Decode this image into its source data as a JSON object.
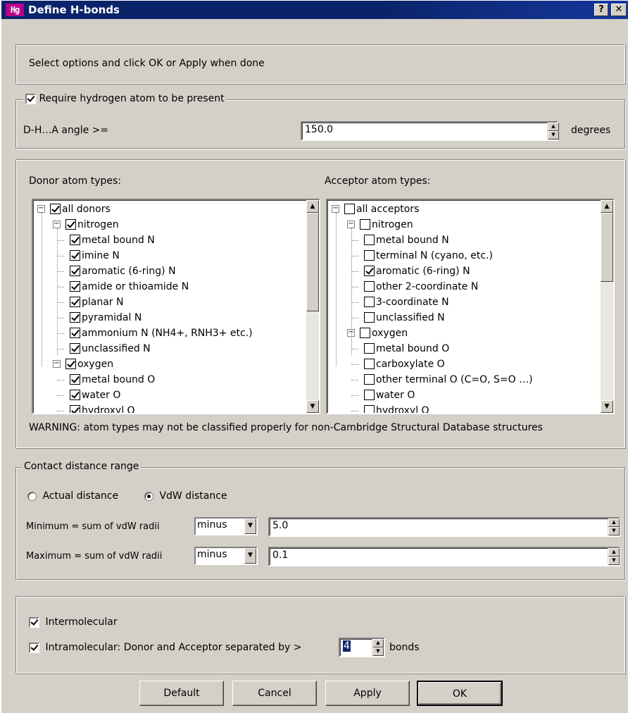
{
  "window": {
    "title": "Define H-bonds",
    "app_icon_text": "Hg",
    "help_btn": "?",
    "close_btn": "✕"
  },
  "intro": {
    "text": "Select options and click OK or Apply when done"
  },
  "hydrogen": {
    "require_label": "Require hydrogen atom to be present",
    "require_checked": true,
    "angle_label": "D-H…A angle >=",
    "angle_value": "150.0",
    "angle_unit": "degrees"
  },
  "donors": {
    "label": "Donor atom types:",
    "items": [
      {
        "label": "all donors",
        "level": 0,
        "checked": true,
        "expander": "−"
      },
      {
        "label": "nitrogen",
        "level": 1,
        "checked": true,
        "expander": "−"
      },
      {
        "label": "metal bound N",
        "level": 2,
        "checked": true
      },
      {
        "label": "imine N",
        "level": 2,
        "checked": true
      },
      {
        "label": "aromatic (6-ring) N",
        "level": 2,
        "checked": true
      },
      {
        "label": "amide or thioamide N",
        "level": 2,
        "checked": true
      },
      {
        "label": "planar N",
        "level": 2,
        "checked": true
      },
      {
        "label": "pyramidal N",
        "level": 2,
        "checked": true
      },
      {
        "label": "ammonium N (NH4+, RNH3+ etc.)",
        "level": 2,
        "checked": true
      },
      {
        "label": "unclassified  N",
        "level": 2,
        "checked": true
      },
      {
        "label": "oxygen",
        "level": 1,
        "checked": true,
        "expander": "−"
      },
      {
        "label": "metal bound O",
        "level": 2,
        "checked": true
      },
      {
        "label": "water O",
        "level": 2,
        "checked": true
      },
      {
        "label": "hydroxyl O",
        "level": 2,
        "checked": true
      }
    ]
  },
  "acceptors": {
    "label": "Acceptor atom types:",
    "items": [
      {
        "label": "all acceptors",
        "level": 0,
        "checked": false,
        "expander": "−"
      },
      {
        "label": "nitrogen",
        "level": 1,
        "checked": false,
        "expander": "−"
      },
      {
        "label": "metal bound N",
        "level": 2,
        "checked": false
      },
      {
        "label": "terminal N (cyano, etc.)",
        "level": 2,
        "checked": false
      },
      {
        "label": "aromatic (6-ring) N",
        "level": 2,
        "checked": true
      },
      {
        "label": "other 2-coordinate N",
        "level": 2,
        "checked": false
      },
      {
        "label": "3-coordinate N",
        "level": 2,
        "checked": false
      },
      {
        "label": "unclassified N",
        "level": 2,
        "checked": false
      },
      {
        "label": "oxygen",
        "level": 1,
        "checked": false,
        "expander": "−"
      },
      {
        "label": "metal bound O",
        "level": 2,
        "checked": false
      },
      {
        "label": "carboxylate O",
        "level": 2,
        "checked": false
      },
      {
        "label": "other terminal O (C=O, S=O …)",
        "level": 2,
        "checked": false
      },
      {
        "label": "water O",
        "level": 2,
        "checked": false
      },
      {
        "label": "hydroxyl O",
        "level": 2,
        "checked": false
      }
    ]
  },
  "warning": "WARNING: atom types may not be classified properly for non-Cambridge Structural Database structures",
  "contact": {
    "legend": "Contact distance range",
    "radio_actual": "Actual distance",
    "radio_vdw": "VdW distance",
    "selected": "vdw",
    "min_label": "Minimum  = sum of vdW radii",
    "min_op": "minus",
    "min_value": "5.0",
    "max_label": "Maximum  = sum of vdW radii",
    "max_op": "minus",
    "max_value": "0.1"
  },
  "molecular": {
    "inter_label": "Intermolecular",
    "inter_checked": true,
    "intra_label": "Intramolecular: Donor and Acceptor separated by >",
    "intra_checked": true,
    "intra_value": "4",
    "intra_unit": "bonds"
  },
  "buttons": {
    "default": "Default",
    "cancel": "Cancel",
    "apply": "Apply",
    "ok": "OK"
  }
}
